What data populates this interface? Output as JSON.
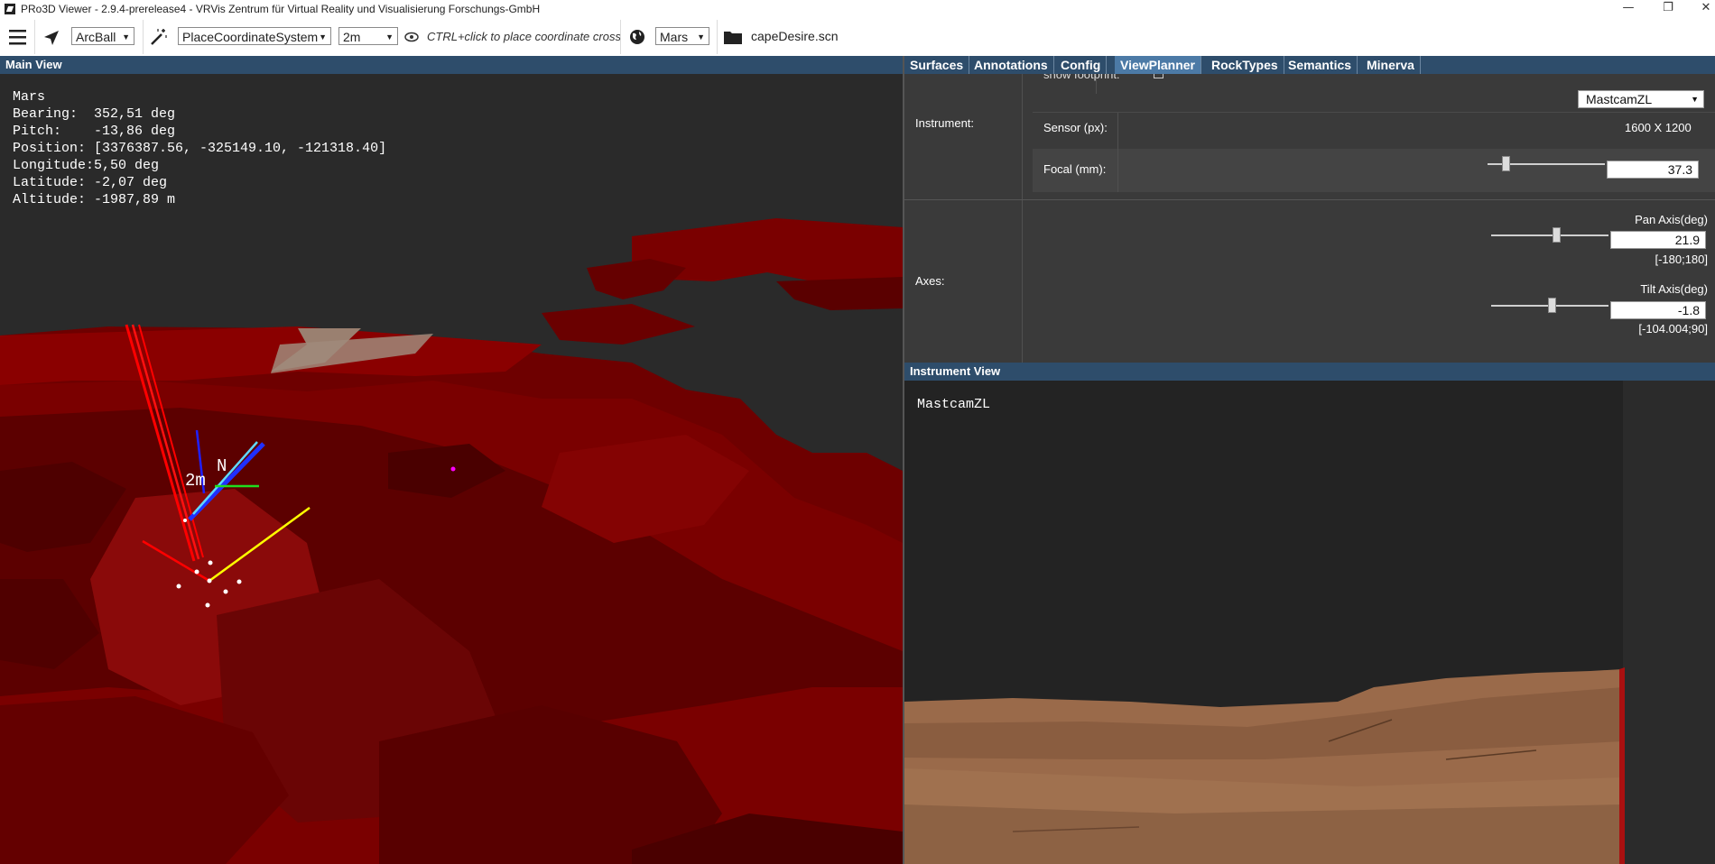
{
  "window": {
    "title": "PRo3D Viewer - 2.9.4-prerelease4 - VRVis Zentrum für Virtual Reality und Visualisierung Forschungs-GmbH"
  },
  "toolbar": {
    "navigation_mode": "ArcBall",
    "tool_mode": "PlaceCoordinateSystem",
    "scale": "2m",
    "hint": "CTRL+click to place coordinate cross",
    "planet": "Mars",
    "scene_file": "capeDesire.scn"
  },
  "main_view": {
    "header": "Main View",
    "overlay": {
      "planet": "Mars",
      "bearing": "Bearing:  352,51 deg",
      "pitch": "Pitch:    -13,86 deg",
      "position": "Position: [3376387.56, -325149.10, -121318.40]",
      "longitude": "Longitude:5,50 deg",
      "latitude": "Latitude: -2,07 deg",
      "altitude": "Altitude: -1987,89 m"
    },
    "scale_label": "2m",
    "north_label": "N"
  },
  "tabs": [
    "Surfaces",
    "Annotations",
    "Config",
    "ViewPlanner",
    "RockTypes",
    "Semantics",
    "Minerva"
  ],
  "view_planner": {
    "show_footprint_label": "show footprint:",
    "instrument_label": "Instrument:",
    "instrument_selected": "MastcamZL",
    "sensor_label": "Sensor (px):",
    "sensor_value": "1600 X 1200",
    "focal_label": "Focal (mm):",
    "focal_value": "37.3",
    "axes_label": "Axes:",
    "pan_label": "Pan Axis(deg)",
    "pan_value": "21.9",
    "pan_range": "[-180;180]",
    "tilt_label": "Tilt Axis(deg)",
    "tilt_value": "-1.8",
    "tilt_range": "[-104.004;90]",
    "focal_slider_fraction": 0.16,
    "pan_slider_fraction": 0.56,
    "tilt_slider_fraction": 0.52
  },
  "instrument_view": {
    "header": "Instrument View",
    "instrument": "MastcamZL"
  },
  "colors": {
    "panel_header": "#2e4d6b",
    "active_tab": "#4c7aa6",
    "terrain_red": "#7a0000",
    "instrument_ground": "#9a6a4a"
  }
}
